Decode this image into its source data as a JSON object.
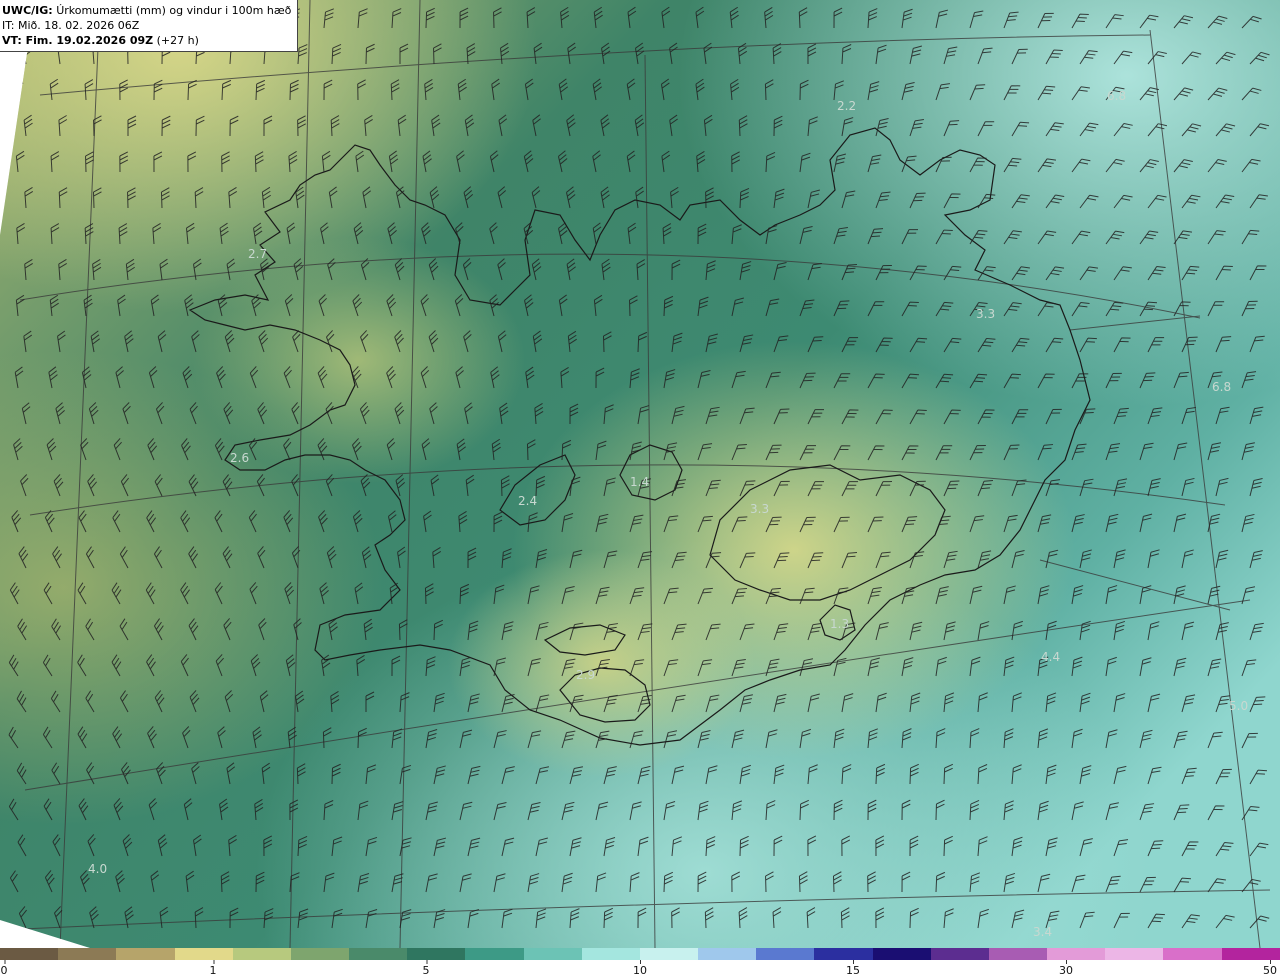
{
  "header": {
    "model": "UWC/IG:",
    "title": "Úrkomumætti (mm) og vindur i 100m hæð",
    "it_line": "IT: Mið. 18. 02. 2026 06Z",
    "vt_bold": "VT: Fim. 19.02.2026 09Z",
    "vt_rest": "(+27 h)"
  },
  "map": {
    "value_labels": [
      {
        "text": "2.7"
      },
      {
        "text": "2.6"
      },
      {
        "text": "2.4"
      },
      {
        "text": "2.2"
      },
      {
        "text": "3.3"
      },
      {
        "text": "3.3"
      },
      {
        "text": "6.8"
      },
      {
        "text": "6.8"
      },
      {
        "text": "4.4"
      },
      {
        "text": "5.0"
      },
      {
        "text": "4.0"
      },
      {
        "text": "3.4"
      },
      {
        "text": "2.9"
      },
      {
        "text": "1.4"
      },
      {
        "text": "1.3"
      }
    ],
    "colors": {
      "coast": "#1a1a1a",
      "graticule": "#3a3a3a",
      "barb": "#222222",
      "label": "#c8d8d0"
    }
  },
  "colorbar": {
    "ticks": [
      "0",
      "1",
      "5",
      "10",
      "15",
      "30",
      "50"
    ],
    "palette": [
      "#6b5a43",
      "#8c7a55",
      "#b6a46a",
      "#e2d98a",
      "#b7c97e",
      "#7ea56e",
      "#4a8a6a",
      "#2f7660",
      "#3d9a86",
      "#6cc3b5",
      "#a4e6df",
      "#c8f1ee",
      "#9fc8ec",
      "#5a79d0",
      "#2b2fa0",
      "#1a0e72",
      "#5c2d90",
      "#a85cb3",
      "#e39bd8",
      "#ecb6e6",
      "#d96fc9",
      "#b3249e"
    ]
  }
}
